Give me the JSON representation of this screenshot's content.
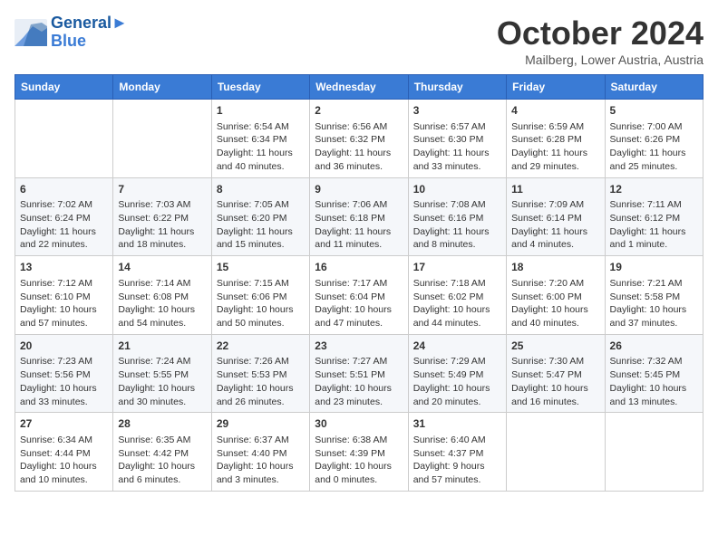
{
  "header": {
    "logo_line1": "General",
    "logo_line2": "Blue",
    "month": "October 2024",
    "location": "Mailberg, Lower Austria, Austria"
  },
  "days_of_week": [
    "Sunday",
    "Monday",
    "Tuesday",
    "Wednesday",
    "Thursday",
    "Friday",
    "Saturday"
  ],
  "weeks": [
    [
      {
        "day": "",
        "info": ""
      },
      {
        "day": "",
        "info": ""
      },
      {
        "day": "1",
        "info": "Sunrise: 6:54 AM\nSunset: 6:34 PM\nDaylight: 11 hours and 40 minutes."
      },
      {
        "day": "2",
        "info": "Sunrise: 6:56 AM\nSunset: 6:32 PM\nDaylight: 11 hours and 36 minutes."
      },
      {
        "day": "3",
        "info": "Sunrise: 6:57 AM\nSunset: 6:30 PM\nDaylight: 11 hours and 33 minutes."
      },
      {
        "day": "4",
        "info": "Sunrise: 6:59 AM\nSunset: 6:28 PM\nDaylight: 11 hours and 29 minutes."
      },
      {
        "day": "5",
        "info": "Sunrise: 7:00 AM\nSunset: 6:26 PM\nDaylight: 11 hours and 25 minutes."
      }
    ],
    [
      {
        "day": "6",
        "info": "Sunrise: 7:02 AM\nSunset: 6:24 PM\nDaylight: 11 hours and 22 minutes."
      },
      {
        "day": "7",
        "info": "Sunrise: 7:03 AM\nSunset: 6:22 PM\nDaylight: 11 hours and 18 minutes."
      },
      {
        "day": "8",
        "info": "Sunrise: 7:05 AM\nSunset: 6:20 PM\nDaylight: 11 hours and 15 minutes."
      },
      {
        "day": "9",
        "info": "Sunrise: 7:06 AM\nSunset: 6:18 PM\nDaylight: 11 hours and 11 minutes."
      },
      {
        "day": "10",
        "info": "Sunrise: 7:08 AM\nSunset: 6:16 PM\nDaylight: 11 hours and 8 minutes."
      },
      {
        "day": "11",
        "info": "Sunrise: 7:09 AM\nSunset: 6:14 PM\nDaylight: 11 hours and 4 minutes."
      },
      {
        "day": "12",
        "info": "Sunrise: 7:11 AM\nSunset: 6:12 PM\nDaylight: 11 hours and 1 minute."
      }
    ],
    [
      {
        "day": "13",
        "info": "Sunrise: 7:12 AM\nSunset: 6:10 PM\nDaylight: 10 hours and 57 minutes."
      },
      {
        "day": "14",
        "info": "Sunrise: 7:14 AM\nSunset: 6:08 PM\nDaylight: 10 hours and 54 minutes."
      },
      {
        "day": "15",
        "info": "Sunrise: 7:15 AM\nSunset: 6:06 PM\nDaylight: 10 hours and 50 minutes."
      },
      {
        "day": "16",
        "info": "Sunrise: 7:17 AM\nSunset: 6:04 PM\nDaylight: 10 hours and 47 minutes."
      },
      {
        "day": "17",
        "info": "Sunrise: 7:18 AM\nSunset: 6:02 PM\nDaylight: 10 hours and 44 minutes."
      },
      {
        "day": "18",
        "info": "Sunrise: 7:20 AM\nSunset: 6:00 PM\nDaylight: 10 hours and 40 minutes."
      },
      {
        "day": "19",
        "info": "Sunrise: 7:21 AM\nSunset: 5:58 PM\nDaylight: 10 hours and 37 minutes."
      }
    ],
    [
      {
        "day": "20",
        "info": "Sunrise: 7:23 AM\nSunset: 5:56 PM\nDaylight: 10 hours and 33 minutes."
      },
      {
        "day": "21",
        "info": "Sunrise: 7:24 AM\nSunset: 5:55 PM\nDaylight: 10 hours and 30 minutes."
      },
      {
        "day": "22",
        "info": "Sunrise: 7:26 AM\nSunset: 5:53 PM\nDaylight: 10 hours and 26 minutes."
      },
      {
        "day": "23",
        "info": "Sunrise: 7:27 AM\nSunset: 5:51 PM\nDaylight: 10 hours and 23 minutes."
      },
      {
        "day": "24",
        "info": "Sunrise: 7:29 AM\nSunset: 5:49 PM\nDaylight: 10 hours and 20 minutes."
      },
      {
        "day": "25",
        "info": "Sunrise: 7:30 AM\nSunset: 5:47 PM\nDaylight: 10 hours and 16 minutes."
      },
      {
        "day": "26",
        "info": "Sunrise: 7:32 AM\nSunset: 5:45 PM\nDaylight: 10 hours and 13 minutes."
      }
    ],
    [
      {
        "day": "27",
        "info": "Sunrise: 6:34 AM\nSunset: 4:44 PM\nDaylight: 10 hours and 10 minutes."
      },
      {
        "day": "28",
        "info": "Sunrise: 6:35 AM\nSunset: 4:42 PM\nDaylight: 10 hours and 6 minutes."
      },
      {
        "day": "29",
        "info": "Sunrise: 6:37 AM\nSunset: 4:40 PM\nDaylight: 10 hours and 3 minutes."
      },
      {
        "day": "30",
        "info": "Sunrise: 6:38 AM\nSunset: 4:39 PM\nDaylight: 10 hours and 0 minutes."
      },
      {
        "day": "31",
        "info": "Sunrise: 6:40 AM\nSunset: 4:37 PM\nDaylight: 9 hours and 57 minutes."
      },
      {
        "day": "",
        "info": ""
      },
      {
        "day": "",
        "info": ""
      }
    ]
  ]
}
